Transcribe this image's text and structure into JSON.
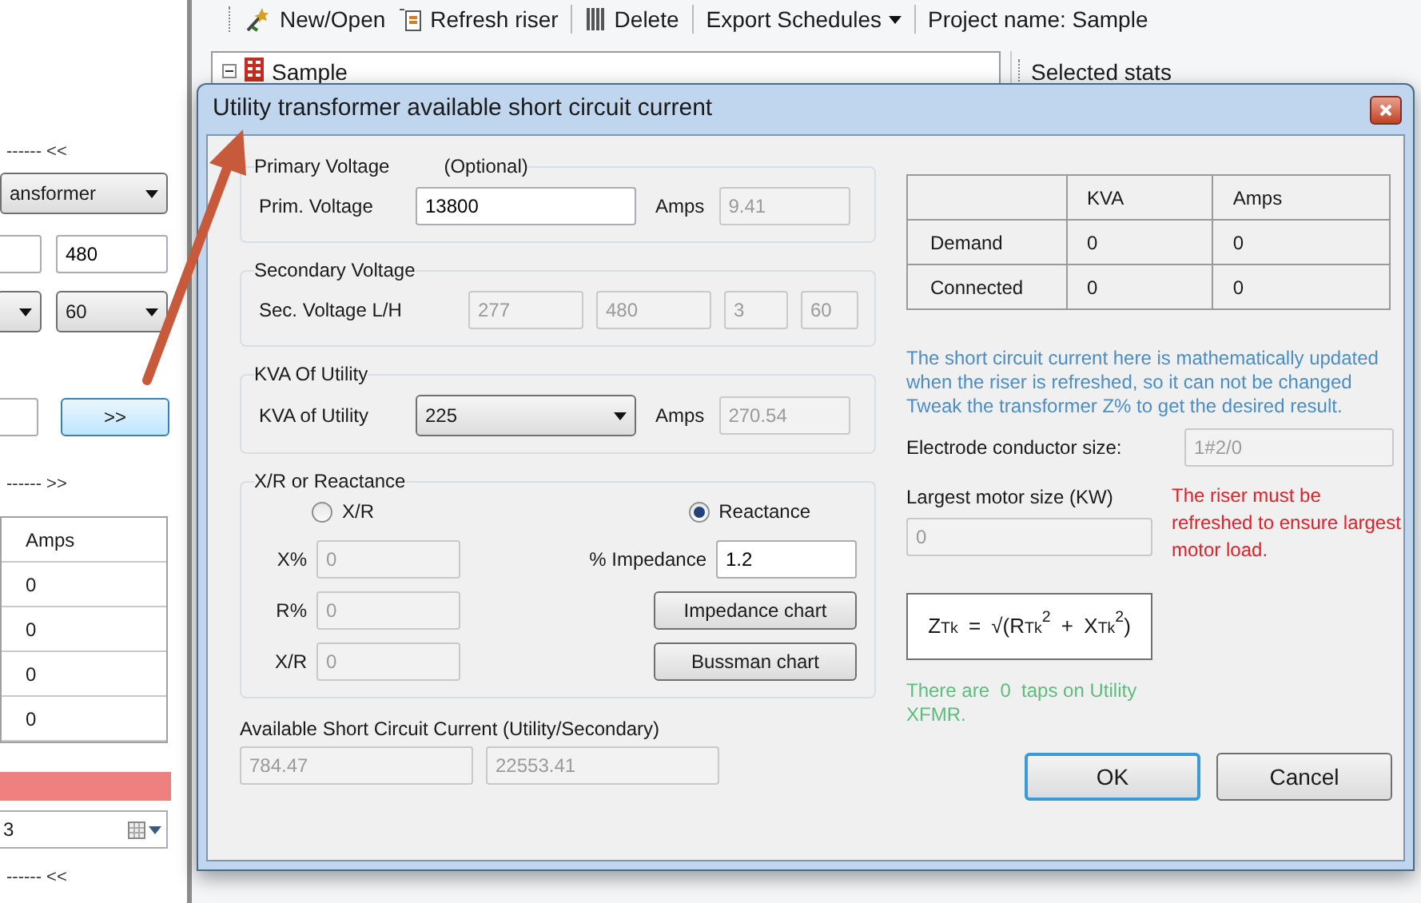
{
  "toolbar": {
    "items": [
      {
        "kind": "button",
        "label": "New/Open"
      },
      {
        "kind": "button",
        "label": "Refresh riser"
      },
      {
        "kind": "button",
        "label": "Delete"
      },
      {
        "kind": "dropdown",
        "label": "Export Schedules"
      },
      {
        "kind": "label",
        "label": "Project name: Sample"
      }
    ]
  },
  "tree": {
    "root": "Sample",
    "expanded": true
  },
  "stats_panel": {
    "title": "Selected stats"
  },
  "side_panel": {
    "section_top": "------ <<",
    "type_combo": "ansformer",
    "voltage": "480",
    "frequency_combo": "60",
    "next_button": ">>",
    "section_middle": "------ >>",
    "table": {
      "columns": [
        "Amps"
      ],
      "rows": [
        [
          "0"
        ],
        [
          "0"
        ],
        [
          "0"
        ],
        [
          "0"
        ]
      ]
    },
    "date_field": "3",
    "section_bottom": "------ <<"
  },
  "dialog": {
    "title": "Utility transformer available short circuit current",
    "primary_voltage": {
      "title": "Primary Voltage",
      "note": "(Optional)",
      "label": "Prim. Voltage",
      "value": "13800",
      "amps_label": "Amps",
      "amps": "9.41"
    },
    "secondary_voltage": {
      "title": "Secondary Voltage",
      "label": "Sec. Voltage L/H",
      "values": [
        "277",
        "480",
        "3",
        "60"
      ]
    },
    "kva": {
      "title": "KVA Of Utility",
      "label": "KVA of Utility",
      "value": "225",
      "amps_label": "Amps",
      "amps": "270.54"
    },
    "reactance": {
      "title": "X/R or Reactance",
      "options": [
        {
          "label": "X/R",
          "selected": false
        },
        {
          "label": "Reactance",
          "selected": true
        }
      ],
      "fields": [
        {
          "label": "X%",
          "value": "0"
        },
        {
          "label": "R%",
          "value": "0"
        },
        {
          "label": "X/R",
          "value": "0"
        }
      ],
      "impedance_label": "% Impedance",
      "impedance": "1.2",
      "buttons": [
        "Impedance chart",
        "Bussman chart"
      ]
    },
    "available_current": {
      "label": "Available Short Circuit Current (Utility/Secondary)",
      "values": [
        "784.47",
        "22553.41"
      ]
    },
    "stats_table": {
      "columns": [
        "KVA",
        "Amps"
      ],
      "rows": [
        {
          "label": "Demand",
          "values": [
            "0",
            "0"
          ]
        },
        {
          "label": "Connected",
          "values": [
            "0",
            "0"
          ]
        }
      ]
    },
    "refresh_note": "The short circuit current here is mathematically updated when the riser is refreshed, so it can not be changed  Tweak the transformer Z% to get the desired result.",
    "electrode": {
      "label": "Electrode conductor size:",
      "value": "1#2/0"
    },
    "motor": {
      "label": "Largest motor size (KW)",
      "value": "0",
      "warning": "The riser must be refreshed to ensure largest motor load."
    },
    "formula": "Z$_{Tk}$ = √(R$_{Tk}$$^{2}$ + X$_{Tk}$$^{2}$)",
    "taps_note": "There are  0  taps on Utility XFMR.",
    "buttons": [
      {
        "label": "OK",
        "default": true
      },
      {
        "label": "Cancel",
        "default": false
      }
    ]
  }
}
